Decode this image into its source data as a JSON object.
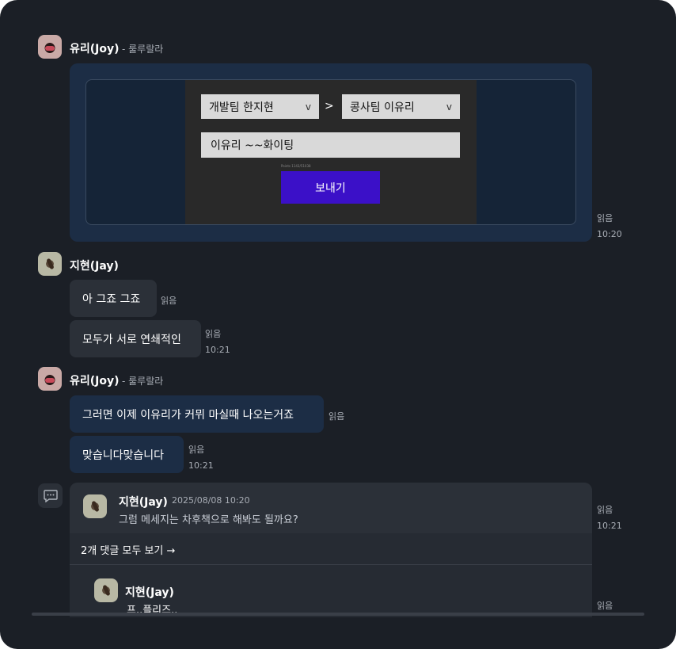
{
  "messages": {
    "joy_name": "유리(Joy)",
    "joy_status": "- 룰루랄라",
    "jay_name": "지현(Jay)",
    "read_label": "읽음",
    "time_1020": "10:20",
    "time_1021": "10:21",
    "bubble1": "아 그죠 그죠",
    "bubble2": "모두가 서로 연쇄적인",
    "bubble3": "그러면 이제 이유리가 커뮈 마실때 나오는거죠",
    "bubble4": "맞습니다맞습니다"
  },
  "card": {
    "from_select": "개발팀 한지현",
    "gt": ">",
    "to_select": "콩사팀 이유리",
    "chevron": "v",
    "message_value": "이유리 ~~화이팅",
    "tiny_text": "Points 1143/51038",
    "send_label": "보내기"
  },
  "thread": {
    "author": "지현(Jay)",
    "timestamp": "2025/08/08 10:20",
    "text": "그럼 메세지는 차후책으로 해봐도 될까요?",
    "view_all": "2개 댓글 모두 보기 →",
    "reply_author": "지현(Jay)",
    "reply_text": "프..플리즈.."
  },
  "icons": {
    "thread": "speech-bubble-icon"
  },
  "colors": {
    "background": "#1b1f26",
    "bubble_dark": "#2b3038",
    "bubble_blue": "#1c2d45",
    "send_button": "#3b10c8"
  }
}
